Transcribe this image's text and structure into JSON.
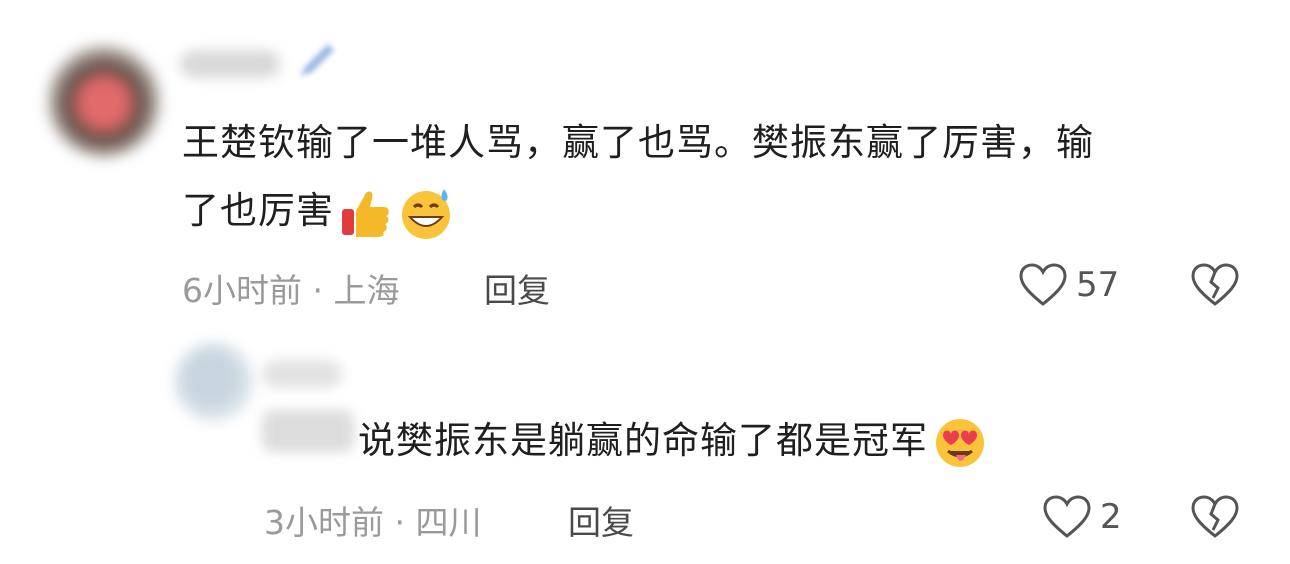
{
  "comment": {
    "text_line1": "王楚钦输了一堆人骂，赢了也骂。樊振东赢了厉害，输",
    "text_line2": "了也厉害",
    "emojis": [
      "thumbs-up-icon",
      "grinning-sweat-icon"
    ],
    "time_location": "6小时前 · 上海",
    "reply_label": "回复",
    "likes": "57"
  },
  "reply": {
    "text": "说樊振东是躺赢的命输了都是冠军",
    "emojis": [
      "heart-eyes-tongue-icon"
    ],
    "time_location": "3小时前 · 四川",
    "reply_label": "回复",
    "likes": "2"
  }
}
